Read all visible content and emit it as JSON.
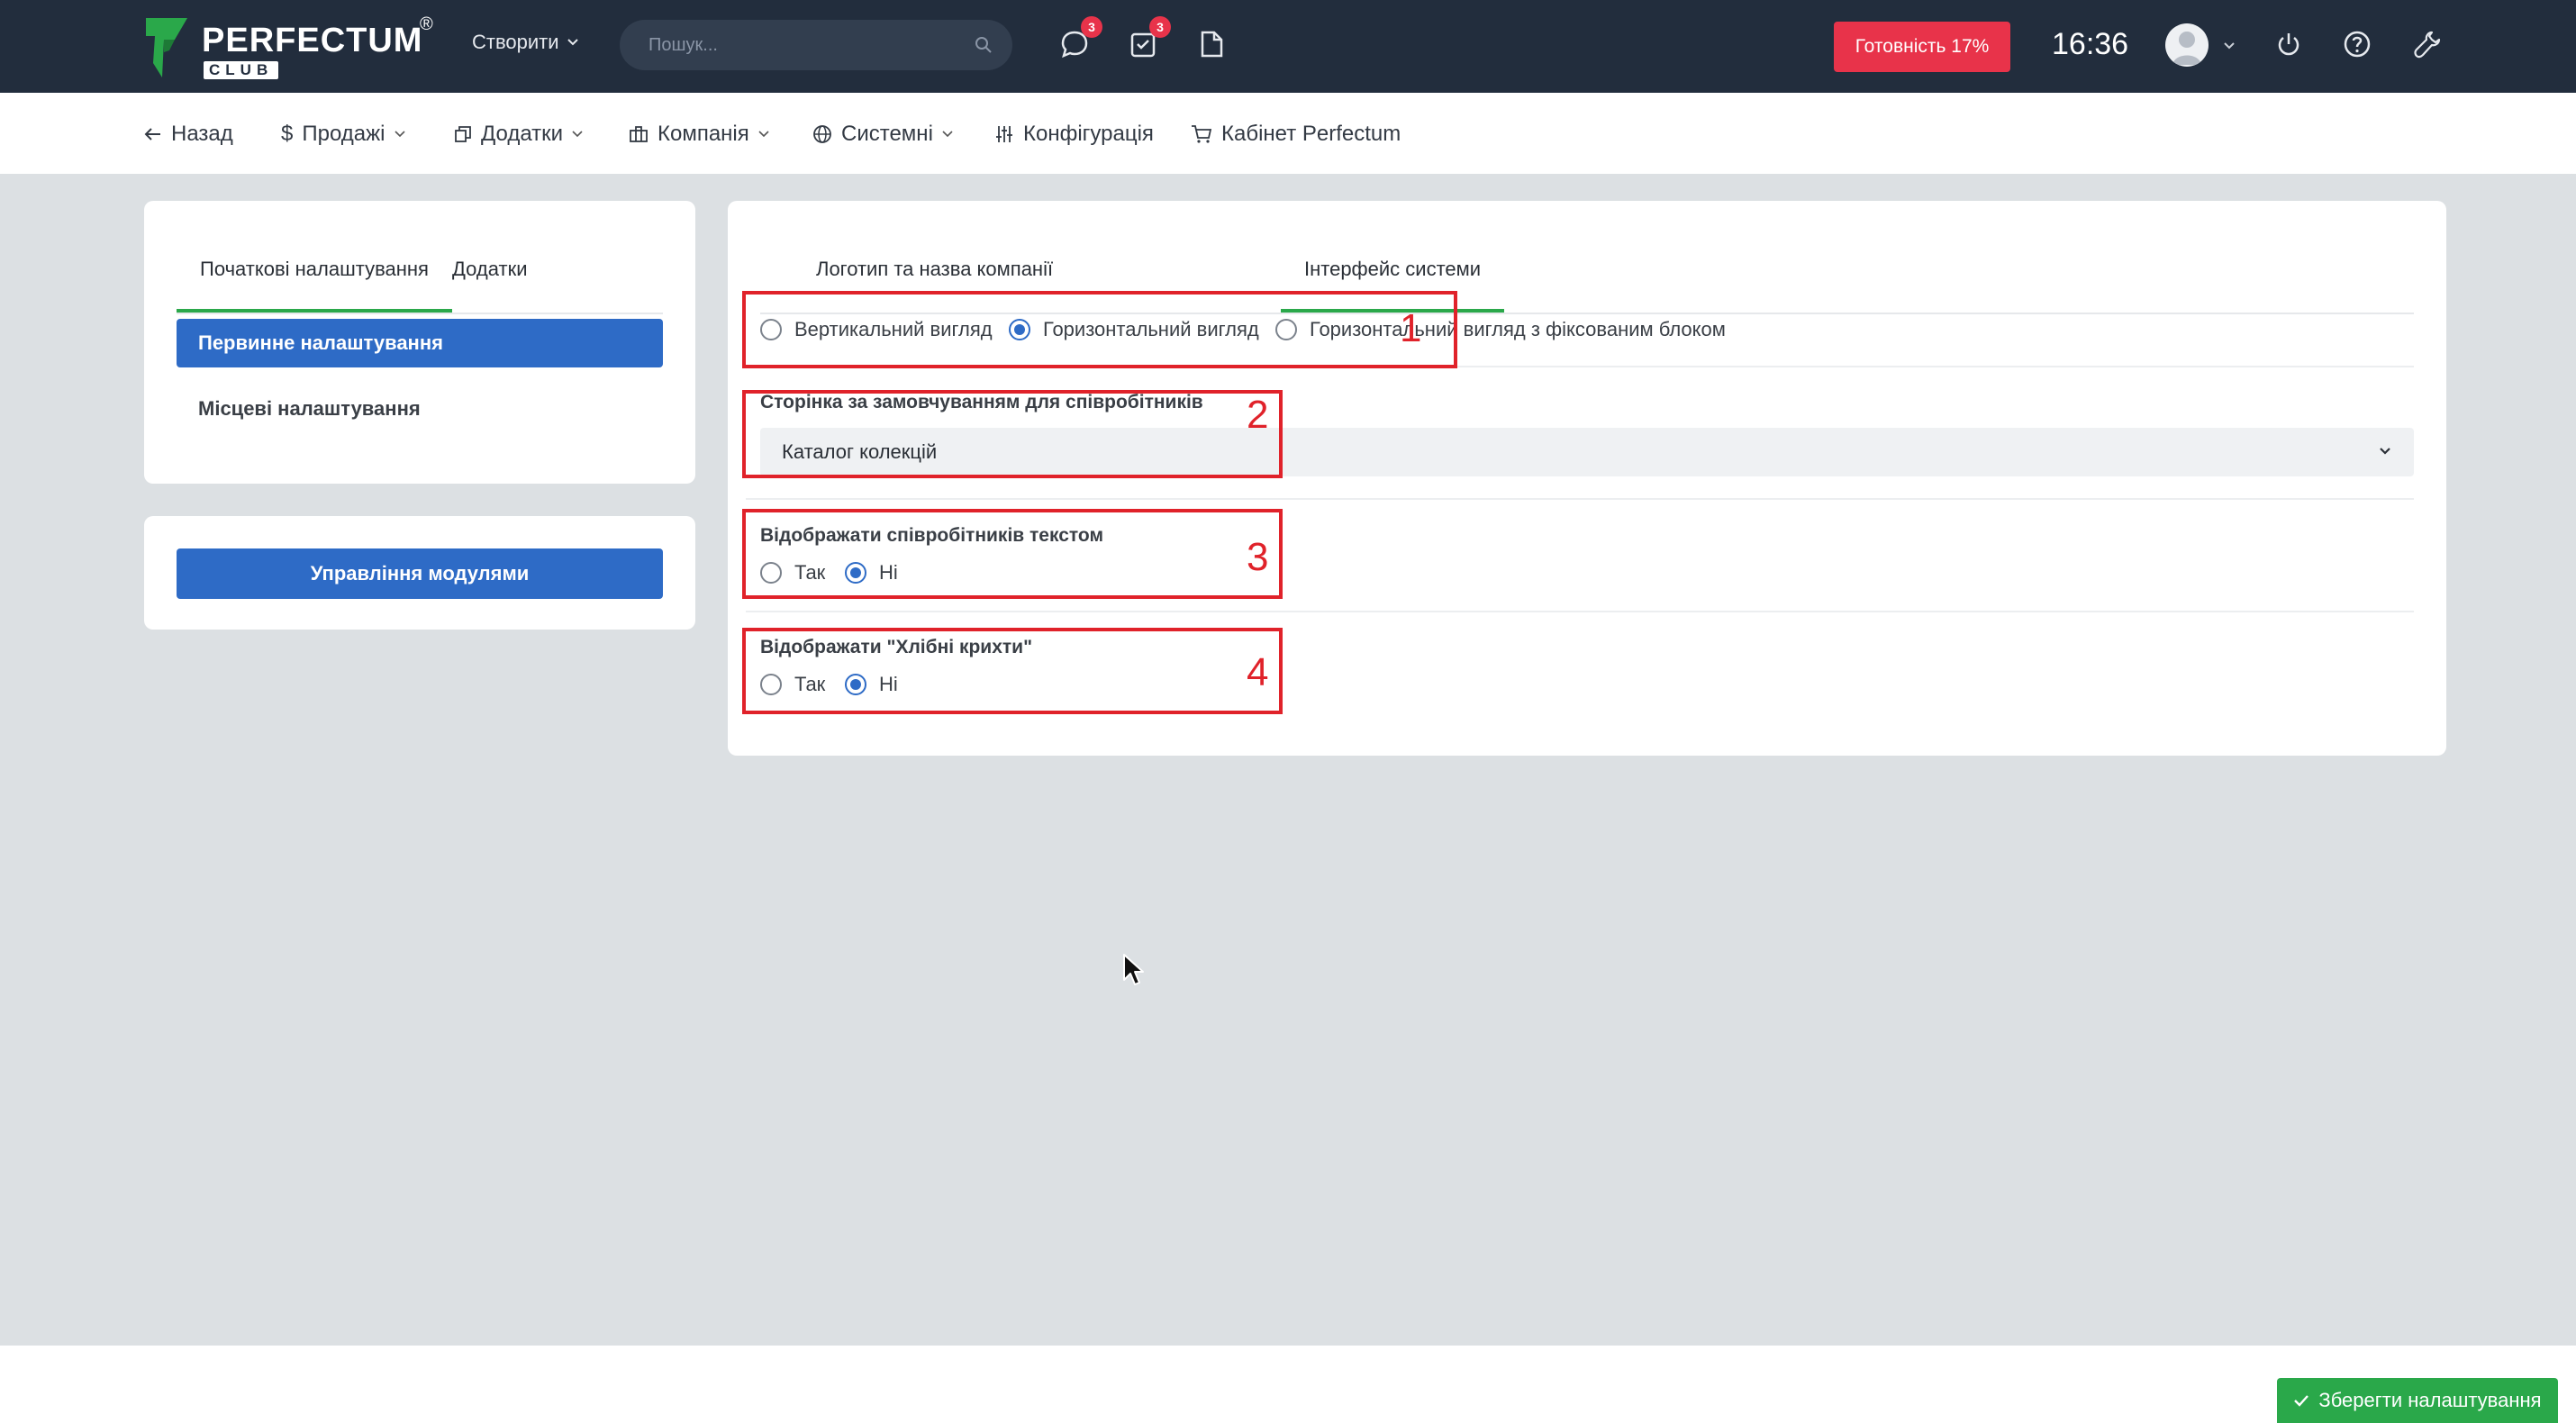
{
  "topbar": {
    "logo_text": "PERFECTUM",
    "logo_reg": "®",
    "logo_club": "CLUB",
    "create_label": "Створити",
    "search_placeholder": "Пошук...",
    "chat_badge": "3",
    "tasks_badge": "3",
    "ready_label": "Готовність 17%",
    "clock": "16:36",
    "icons": [
      "chat-icon",
      "tasks-icon",
      "document-icon",
      "power-icon",
      "help-icon",
      "wrench-icon"
    ]
  },
  "nav": {
    "items": [
      {
        "label": "Назад",
        "icon": "arrow-left-icon"
      },
      {
        "label": "Продажі",
        "icon": "dollar-icon"
      },
      {
        "label": "Додатки",
        "icon": "copy-icon"
      },
      {
        "label": "Компанія",
        "icon": "briefcase-icon"
      },
      {
        "label": "Системні",
        "icon": "globe-icon"
      },
      {
        "label": "Конфігурація",
        "icon": "sliders-icon"
      },
      {
        "label": "Кабінет Perfectum",
        "icon": "cart-icon"
      }
    ]
  },
  "sidebar": {
    "tabs": [
      "Початкові налаштування",
      "Додатки"
    ],
    "links": [
      "Первинне налаштування",
      "Місцеві налаштування"
    ],
    "modules_button": "Управління модулями"
  },
  "main": {
    "tabs": [
      "Логотип та назва компанії",
      "Інтерфейс системи"
    ],
    "layout_options": [
      {
        "label": "Вертикальний вигляд",
        "checked": false
      },
      {
        "label": "Горизонтальний вигляд",
        "checked": true
      },
      {
        "label": "Горизонтальний вигляд з фіксованим блоком",
        "checked": false
      }
    ],
    "default_page_label": "Сторінка за замовчуванням для співробітників",
    "default_page_value": "Каталог колекцій",
    "staff_text_label": "Відображати співробітників текстом",
    "breadcrumbs_label": "Відображати \"Хлібні крихти\"",
    "yes": "Так",
    "no": "Ні",
    "annotations": [
      "1",
      "2",
      "3",
      "4"
    ]
  },
  "footer": {
    "save_label": "Зберегти налаштування"
  },
  "colors": {
    "topbar": "#222d3d",
    "primary": "#2e6bc6",
    "success": "#2aa84a",
    "danger": "#e8334a",
    "annotation": "#e0222a"
  }
}
